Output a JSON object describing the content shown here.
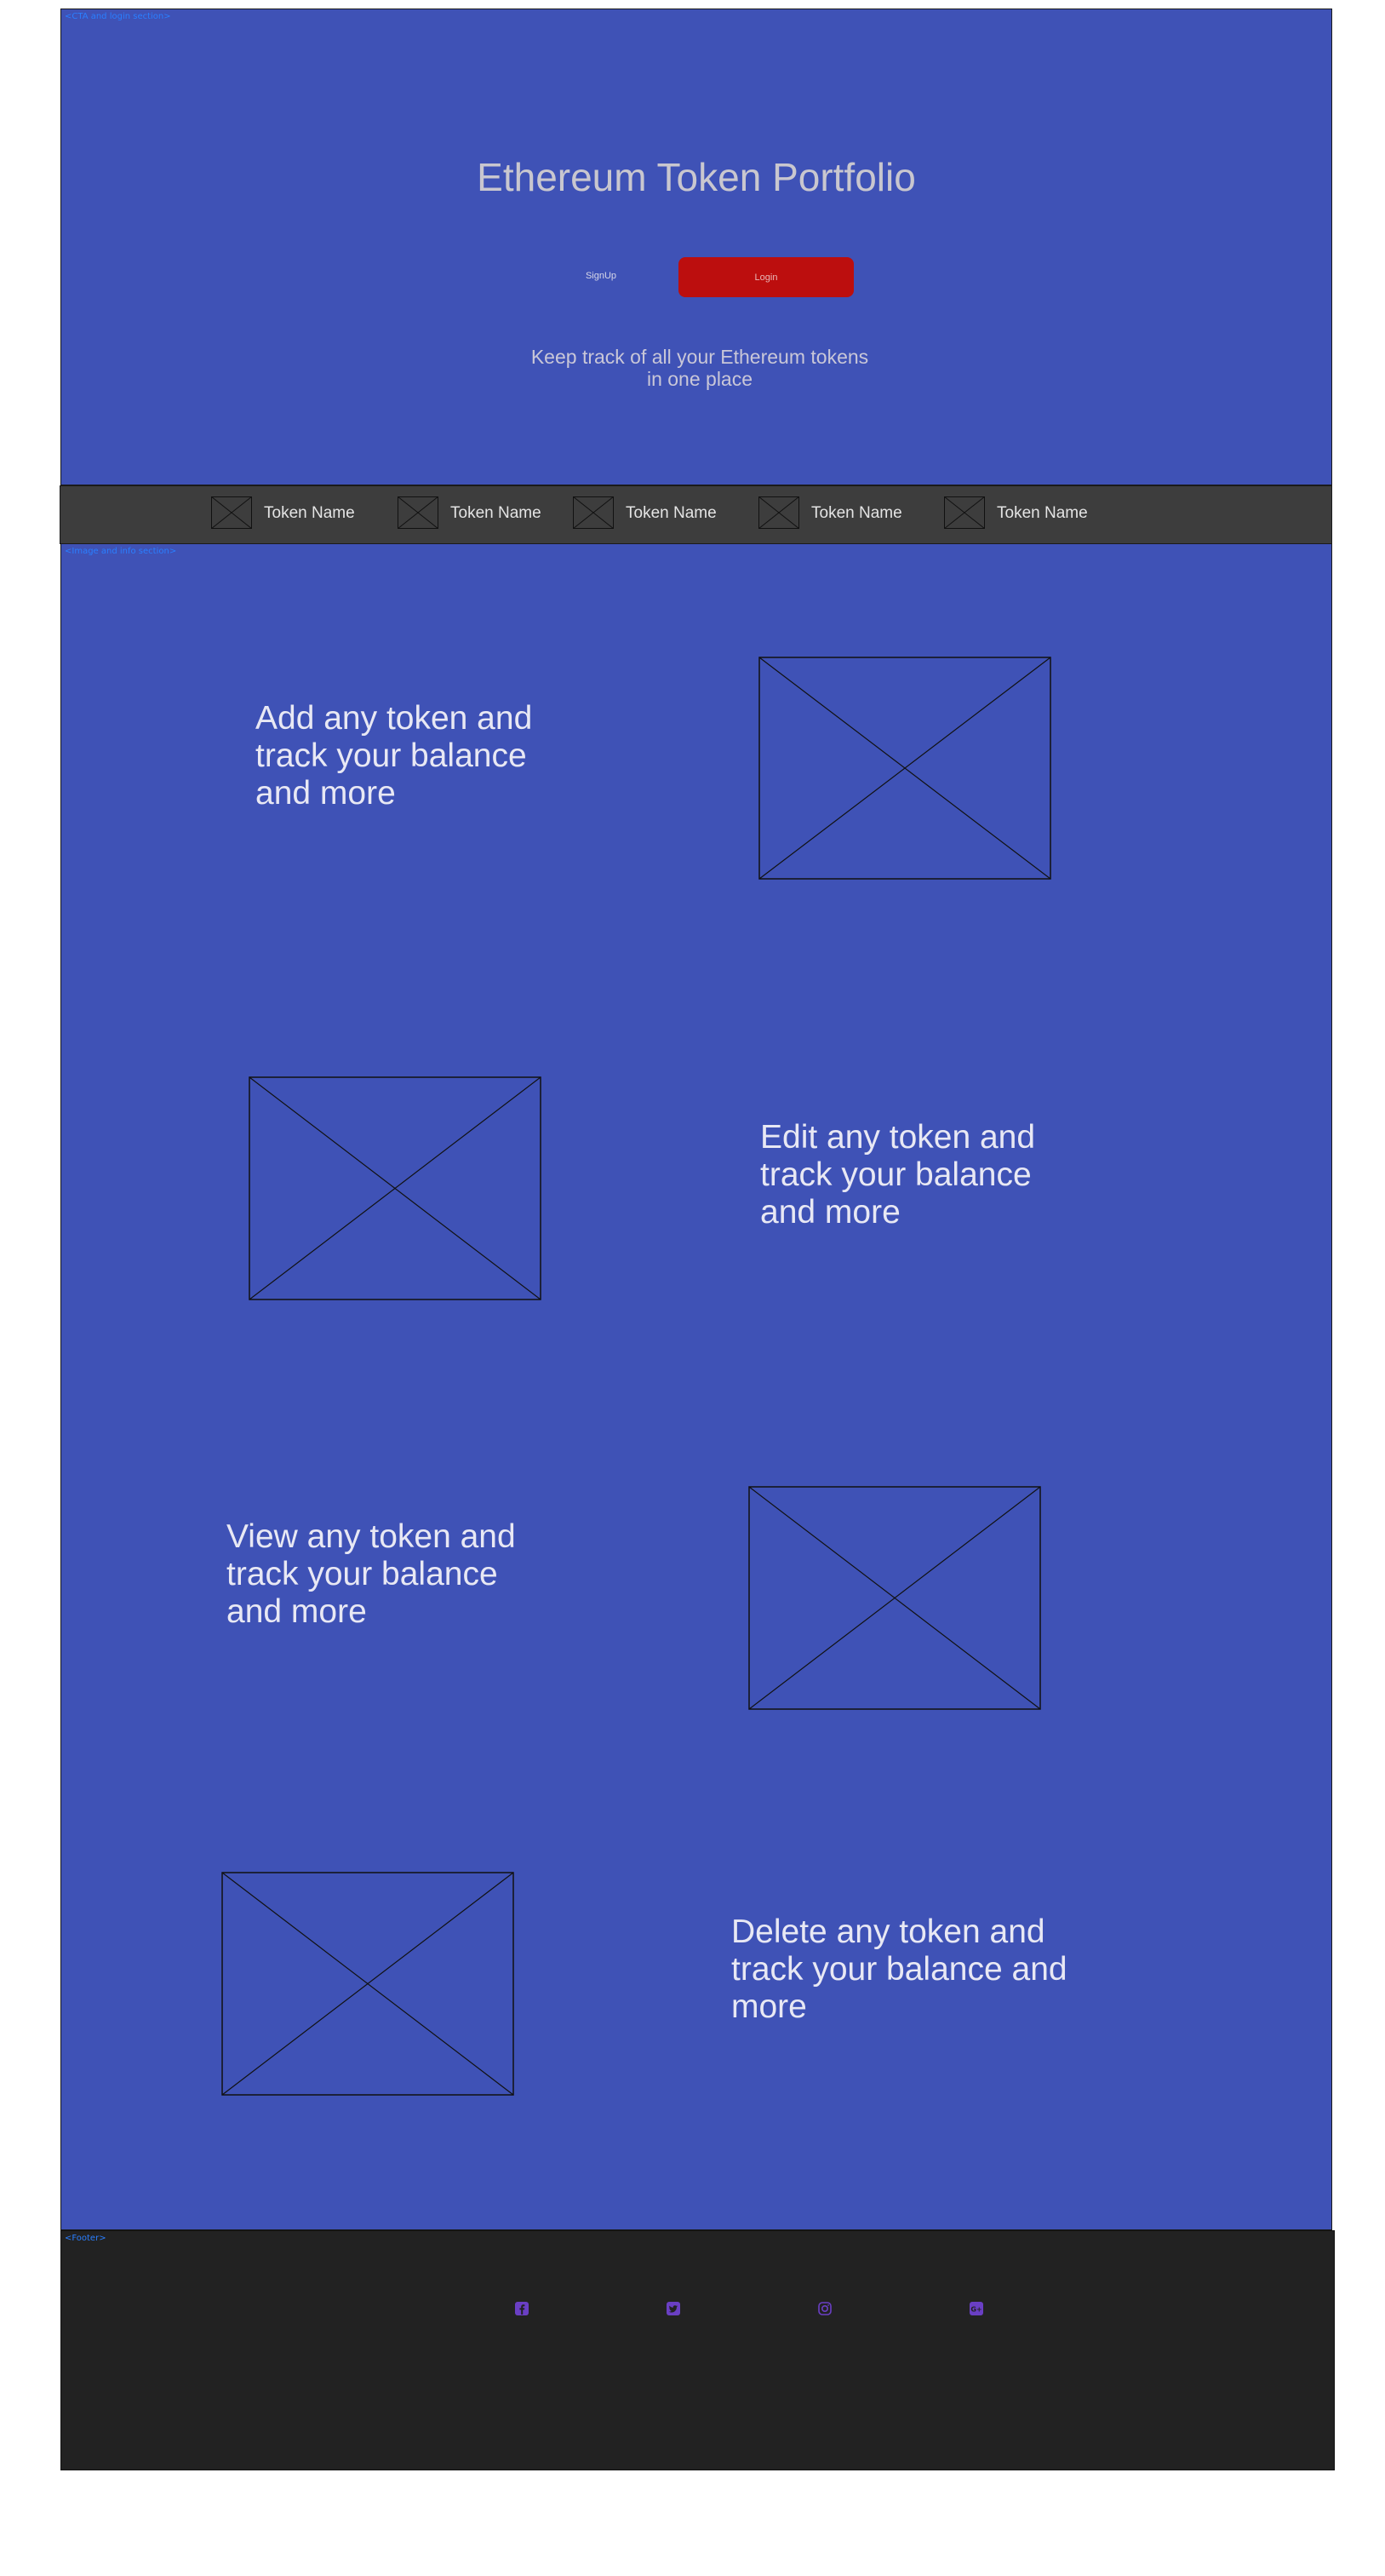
{
  "hero": {
    "section_label": "<CTA and login section>",
    "title": "Ethereum Token Portfolio",
    "signup_label": "SignUp",
    "login_label": "Login",
    "subtitle": "Keep track of all your Ethereum tokens in one place"
  },
  "token_bar": {
    "tokens": [
      {
        "name": "Token Name"
      },
      {
        "name": "Token Name"
      },
      {
        "name": "Token Name"
      },
      {
        "name": "Token Name"
      },
      {
        "name": "Token Name"
      }
    ]
  },
  "main": {
    "section_label": "<Image and info section>",
    "features": [
      {
        "text": "Add any token and track your balance and more"
      },
      {
        "text": "Edit any token and track your balance and more"
      },
      {
        "text": "View any token and track your balance and more"
      },
      {
        "text": "Delete any token and track your balance and more"
      }
    ]
  },
  "footer": {
    "section_label": "<Footer>",
    "icons": [
      "facebook-icon",
      "twitter-icon",
      "instagram-icon",
      "google-plus-icon"
    ]
  },
  "colors": {
    "section_blue": "#3f52b6",
    "token_bar": "#3d3d3d",
    "login_red": "#bc0e0e",
    "footer": "#222222",
    "social_purple": "#6a3fc4"
  }
}
